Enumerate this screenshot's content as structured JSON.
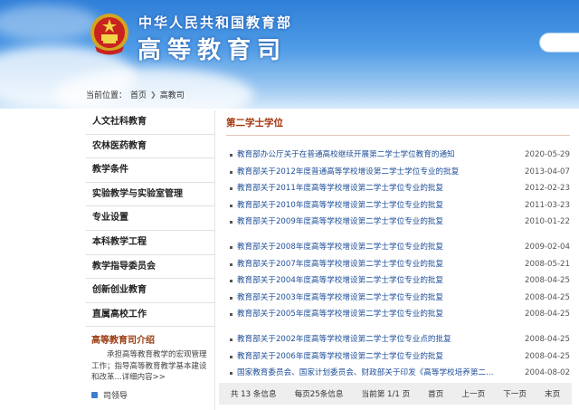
{
  "header": {
    "title_small": "中华人民共和国教育部",
    "title_big": "高等教育司"
  },
  "breadcrumb": {
    "label": "当前位置：",
    "home": "首页",
    "current": "高教司"
  },
  "sidebar": {
    "items": [
      {
        "label": "人文社科教育"
      },
      {
        "label": "农林医药教育"
      },
      {
        "label": "教学条件"
      },
      {
        "label": "实验教学与实验室管理"
      },
      {
        "label": "专业设置"
      },
      {
        "label": "本科教学工程"
      },
      {
        "label": "教学指导委员会"
      },
      {
        "label": "创新创业教育"
      },
      {
        "label": "直属高校工作"
      }
    ],
    "intro_title": "高等教育司介绍",
    "intro_text": "承担高等教育教学的宏观管理工作；指导高等教育教学基本建设和改革...",
    "intro_more": "详细内容>>",
    "leader": "司领导"
  },
  "main": {
    "section_title": "第二学士学位",
    "news": [
      {
        "title": "教育部办公厅关于在普通高校继续开展第二学士学位教育的通知",
        "date": "2020-05-29"
      },
      {
        "title": "教育部关于2012年度普通高等学校增设第二学士学位专业的批复",
        "date": "2013-04-07"
      },
      {
        "title": "教育部关于2011年度高等学校增设第二学士学位专业的批复",
        "date": "2012-02-23"
      },
      {
        "title": "教育部关于2010年度高等学校增设第二学士学位专业的批复",
        "date": "2011-03-23"
      },
      {
        "title": "教育部关于2009年度高等学校增设第二学士学位专业的批复",
        "date": "2010-01-22"
      },
      {
        "title": "教育部关于2008年度高等学校增设第二学士学位专业的批复",
        "date": "2009-02-04"
      },
      {
        "title": "教育部关于2007年度高等学校增设第二学士学位专业的批复",
        "date": "2008-05-21"
      },
      {
        "title": "教育部关于2004年度高等学校增设第二学士学位专业的批复",
        "date": "2008-04-25"
      },
      {
        "title": "教育部关于2003年度高等学校增设第二学士学位专业的批复",
        "date": "2008-04-25"
      },
      {
        "title": "教育部关于2005年度高等学校增设第二学士学位专业的批复",
        "date": "2008-04-25"
      },
      {
        "title": "教育部关于2002年度高等学校增设第二学士学位专业点的批复",
        "date": "2008-04-25"
      },
      {
        "title": "教育部关于2006年度高等学校增设第二学士学位专业的批复",
        "date": "2008-04-25"
      },
      {
        "title": "国家教育委员会、国家计划委员会、财政部关于印发《高等学校培养第二学...",
        "date": "2004-08-02"
      }
    ],
    "pager": {
      "total": "共 13 条信息",
      "per_page": "每页25条信息",
      "current": "当前第 1/1 页",
      "first": "首页",
      "prev": "上一页",
      "next": "下一页",
      "last": "末页"
    }
  },
  "colors": {
    "accent": "#a4350b",
    "link": "#1f4f99",
    "banner": "#2f7fd8"
  }
}
